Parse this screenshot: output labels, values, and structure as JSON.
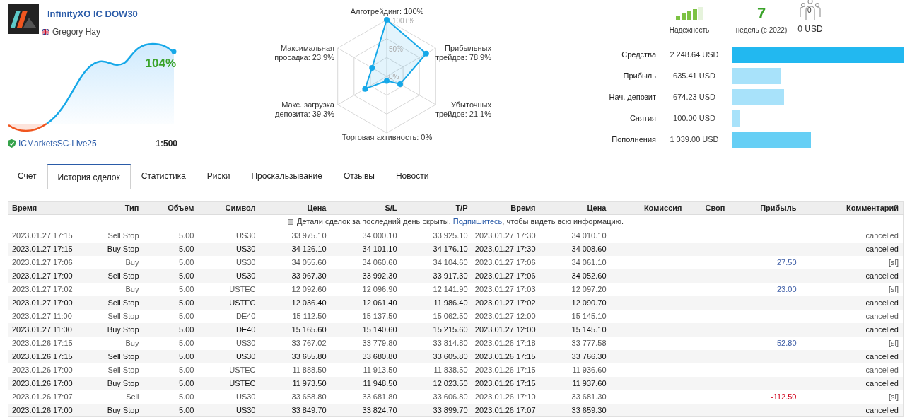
{
  "profile": {
    "title": "InfinityXO IC DOW30",
    "author": "Gregory Hay",
    "growth": "104%",
    "server": "ICMarketsSC-Live25",
    "leverage": "1:500"
  },
  "radar": {
    "ticks": [
      "100+%",
      "50%",
      "0%"
    ],
    "axes": [
      "Алготрейдинг: 100%",
      "Максимальная просадка: 23.9%",
      "Прибыльных трейдов: 78.9%",
      "Макс. загрузка депозита: 39.3%",
      "Убыточных трейдов: 21.1%",
      "Торговая активность: 0%"
    ]
  },
  "reliability": {
    "label": "Надежность"
  },
  "weeks": {
    "value": "7",
    "label": "недель (с 2022)"
  },
  "subscribers": {
    "count": "0",
    "amount": "0 USD"
  },
  "stats": [
    {
      "label": "Средства",
      "value": "2 248.64 USD",
      "color": "#22b8f0"
    },
    {
      "label": "Прибыль",
      "value": "635.41 USD",
      "color": "#a8e2fa"
    },
    {
      "label": "Нач. депозит",
      "value": "674.23 USD",
      "color": "#a8e2fa"
    },
    {
      "label": "Снятия",
      "value": "100.00 USD",
      "color": "#a8e2fa"
    },
    {
      "label": "Пополнения",
      "value": "1 039.00 USD",
      "color": "#66cff5"
    }
  ],
  "tabs": [
    {
      "label": "Счет",
      "selected": false
    },
    {
      "label": "История сделок",
      "selected": true
    },
    {
      "label": "Статистика",
      "selected": false
    },
    {
      "label": "Риски",
      "selected": false
    },
    {
      "label": "Проскальзывание",
      "selected": false
    },
    {
      "label": "Отзывы",
      "selected": false
    },
    {
      "label": "Новости",
      "selected": false
    }
  ],
  "table": {
    "columns": [
      "Время",
      "Тип",
      "Объем",
      "Символ",
      "Цена",
      "S/L",
      "T/P",
      "Время",
      "Цена",
      "Комиссия",
      "Своп",
      "Прибыль",
      "Комментарий"
    ],
    "notice": {
      "before": "Детали сделок за последний день скрыты. ",
      "link": "Подпишитесь",
      "after": ", чтобы видеть всю информацию."
    },
    "rows": [
      {
        "cells": [
          "2023.01.27 17:15",
          "Sell Stop",
          "5.00",
          "US30",
          "33 975.10",
          "34 000.10",
          "33 925.10",
          "2023.01.27 17:30",
          "34 010.10"
        ],
        "comment": "cancelled"
      },
      {
        "cells": [
          "2023.01.27 17:15",
          "Buy Stop",
          "5.00",
          "US30",
          "34 126.10",
          "34 101.10",
          "34 176.10",
          "2023.01.27 17:30",
          "34 008.60"
        ],
        "comment": "cancelled"
      },
      {
        "cells": [
          "2023.01.27 17:06",
          "Buy",
          "5.00",
          "US30",
          "34 055.60",
          "34 060.60",
          "34 104.60",
          "2023.01.27 17:06",
          "34 061.10"
        ],
        "profit": {
          "text": "27.50",
          "kind": "gain"
        },
        "comment": "[sl]"
      },
      {
        "cells": [
          "2023.01.27 17:00",
          "Sell Stop",
          "5.00",
          "US30",
          "33 967.30",
          "33 992.30",
          "33 917.30",
          "2023.01.27 17:06",
          "34 052.60"
        ],
        "comment": "cancelled"
      },
      {
        "cells": [
          "2023.01.27 17:02",
          "Buy",
          "5.00",
          "USTEC",
          "12 092.60",
          "12 096.90",
          "12 141.90",
          "2023.01.27 17:03",
          "12 097.20"
        ],
        "profit": {
          "text": "23.00",
          "kind": "gain"
        },
        "comment": "[sl]"
      },
      {
        "cells": [
          "2023.01.27 17:00",
          "Sell Stop",
          "5.00",
          "USTEC",
          "12 036.40",
          "12 061.40",
          "11 986.40",
          "2023.01.27 17:02",
          "12 090.70"
        ],
        "comment": "cancelled"
      },
      {
        "cells": [
          "2023.01.27 11:00",
          "Sell Stop",
          "5.00",
          "DE40",
          "15 112.50",
          "15 137.50",
          "15 062.50",
          "2023.01.27 12:00",
          "15 145.10"
        ],
        "comment": "cancelled"
      },
      {
        "cells": [
          "2023.01.27 11:00",
          "Buy Stop",
          "5.00",
          "DE40",
          "15 165.60",
          "15 140.60",
          "15 215.60",
          "2023.01.27 12:00",
          "15 145.10"
        ],
        "comment": "cancelled"
      },
      {
        "cells": [
          "2023.01.26 17:15",
          "Buy",
          "5.00",
          "US30",
          "33 767.02",
          "33 779.80",
          "33 814.80",
          "2023.01.26 17:18",
          "33 777.58"
        ],
        "profit": {
          "text": "52.80",
          "kind": "gain"
        },
        "comment": "[sl]"
      },
      {
        "cells": [
          "2023.01.26 17:15",
          "Sell Stop",
          "5.00",
          "US30",
          "33 655.80",
          "33 680.80",
          "33 605.80",
          "2023.01.26 17:15",
          "33 766.30"
        ],
        "comment": "cancelled"
      },
      {
        "cells": [
          "2023.01.26 17:00",
          "Sell Stop",
          "5.00",
          "USTEC",
          "11 888.50",
          "11 913.50",
          "11 838.50",
          "2023.01.26 17:15",
          "11 936.60"
        ],
        "comment": "cancelled"
      },
      {
        "cells": [
          "2023.01.26 17:00",
          "Buy Stop",
          "5.00",
          "USTEC",
          "11 973.50",
          "11 948.50",
          "12 023.50",
          "2023.01.26 17:15",
          "11 937.60"
        ],
        "comment": "cancelled"
      },
      {
        "cells": [
          "2023.01.26 17:07",
          "Sell",
          "5.00",
          "US30",
          "33 658.80",
          "33 681.80",
          "33 606.80",
          "2023.01.26 17:10",
          "33 681.30"
        ],
        "profit": {
          "text": "-112.50",
          "kind": "loss"
        },
        "comment": "[sl]"
      },
      {
        "cells": [
          "2023.01.26 17:00",
          "Buy Stop",
          "5.00",
          "US30",
          "33 849.70",
          "33 824.70",
          "33 899.70",
          "2023.01.26 17:07",
          "33 659.30"
        ],
        "comment": "cancelled"
      }
    ]
  }
}
